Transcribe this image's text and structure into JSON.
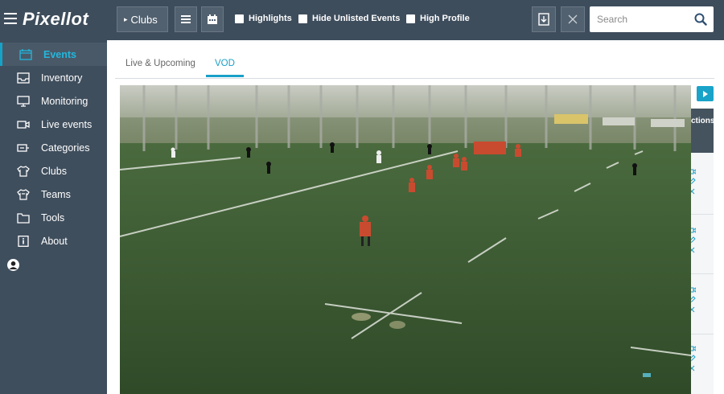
{
  "app": {
    "name": "Pixellot"
  },
  "topbar": {
    "clubs_label": "Clubs",
    "filters": [
      {
        "label": "Highlights",
        "checked": false
      },
      {
        "label": "Hide Unlisted Events",
        "checked": false
      },
      {
        "label": "High Profile",
        "checked": false
      }
    ],
    "search_placeholder": "Search"
  },
  "sidebar": {
    "items": [
      {
        "label": "Events",
        "icon": "calendar-icon",
        "active": true
      },
      {
        "label": "Inventory",
        "icon": "inbox-icon",
        "active": false
      },
      {
        "label": "Monitoring",
        "icon": "monitor-icon",
        "active": false
      },
      {
        "label": "Live events",
        "icon": "video-camera-icon",
        "active": false
      },
      {
        "label": "Categories",
        "icon": "categories-icon",
        "active": false
      },
      {
        "label": "Clubs",
        "icon": "shirt-icon",
        "active": false
      },
      {
        "label": "Teams",
        "icon": "teams-icon",
        "active": false
      },
      {
        "label": "Tools",
        "icon": "folder-icon",
        "active": false
      },
      {
        "label": "About",
        "icon": "info-icon",
        "active": false
      }
    ]
  },
  "main": {
    "tabs": [
      {
        "label": "Live & Upcoming",
        "active": false
      },
      {
        "label": "VOD",
        "active": true
      }
    ],
    "panel_header": "ctions"
  },
  "colors": {
    "accent": "#1aa0c8",
    "topbar": "#3e4d5c",
    "sidebar": "#3f4e5d"
  }
}
